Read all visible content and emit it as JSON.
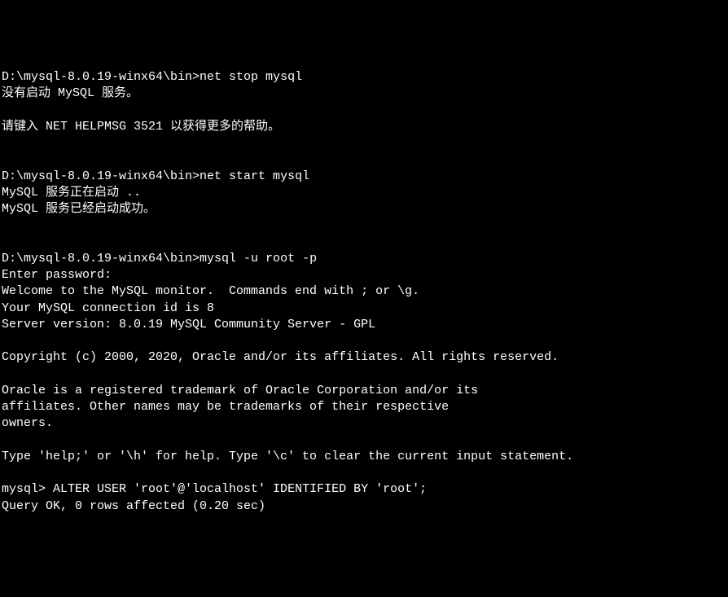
{
  "terminal": {
    "lines": [
      {
        "type": "cmd",
        "prompt": "D:\\mysql-8.0.19-winx64\\bin>",
        "command": "net stop mysql"
      },
      {
        "type": "out",
        "text": "没有启动 MySQL 服务。"
      },
      {
        "type": "blank"
      },
      {
        "type": "out",
        "text": "请键入 NET HELPMSG 3521 以获得更多的帮助。"
      },
      {
        "type": "blank"
      },
      {
        "type": "blank"
      },
      {
        "type": "cmd",
        "prompt": "D:\\mysql-8.0.19-winx64\\bin>",
        "command": "net start mysql"
      },
      {
        "type": "out",
        "text": "MySQL 服务正在启动 .."
      },
      {
        "type": "out",
        "text": "MySQL 服务已经启动成功。"
      },
      {
        "type": "blank"
      },
      {
        "type": "blank"
      },
      {
        "type": "cmd",
        "prompt": "D:\\mysql-8.0.19-winx64\\bin>",
        "command": "mysql -u root -p"
      },
      {
        "type": "out",
        "text": "Enter password:"
      },
      {
        "type": "out",
        "text": "Welcome to the MySQL monitor.  Commands end with ; or \\g."
      },
      {
        "type": "out",
        "text": "Your MySQL connection id is 8"
      },
      {
        "type": "out",
        "text": "Server version: 8.0.19 MySQL Community Server - GPL"
      },
      {
        "type": "blank"
      },
      {
        "type": "out",
        "text": "Copyright (c) 2000, 2020, Oracle and/or its affiliates. All rights reserved."
      },
      {
        "type": "blank"
      },
      {
        "type": "out",
        "text": "Oracle is a registered trademark of Oracle Corporation and/or its"
      },
      {
        "type": "out",
        "text": "affiliates. Other names may be trademarks of their respective"
      },
      {
        "type": "out",
        "text": "owners."
      },
      {
        "type": "blank"
      },
      {
        "type": "out",
        "text": "Type 'help;' or '\\h' for help. Type '\\c' to clear the current input statement."
      },
      {
        "type": "blank"
      },
      {
        "type": "cmd",
        "prompt": "mysql> ",
        "command": "ALTER USER 'root'@'localhost' IDENTIFIED BY 'root';"
      },
      {
        "type": "out",
        "text": "Query OK, 0 rows affected (0.20 sec)"
      }
    ]
  }
}
